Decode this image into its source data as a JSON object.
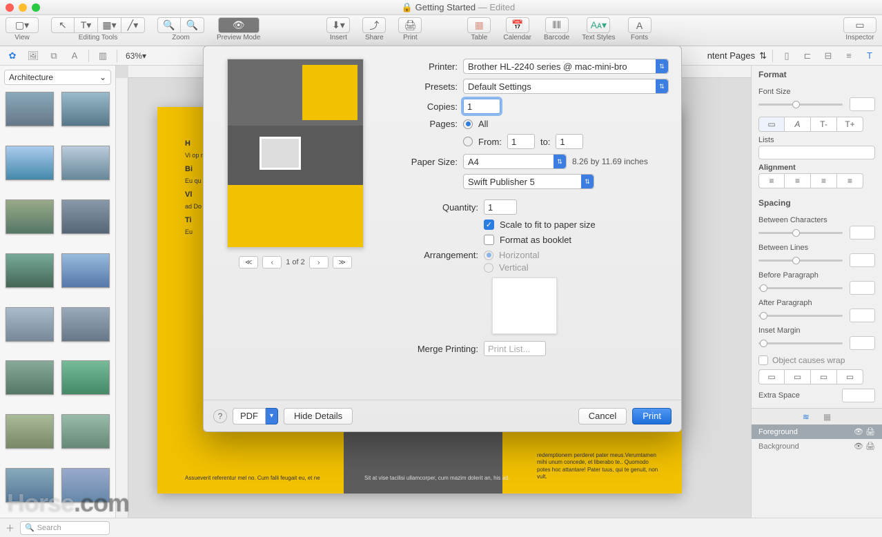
{
  "window": {
    "title": "Getting Started",
    "edited": "— Edited"
  },
  "toolbar": {
    "view": "View",
    "editing": "Editing Tools",
    "zoom": "Zoom",
    "preview": "Preview Mode",
    "insert": "Insert",
    "share": "Share",
    "print": "Print",
    "table": "Table",
    "calendar": "Calendar",
    "barcode": "Barcode",
    "textstyles": "Text Styles",
    "fonts": "Fonts",
    "inspector": "Inspector"
  },
  "secbar": {
    "zoom": "63%",
    "contentpages": "ntent Pages"
  },
  "left": {
    "category": "Architecture",
    "search_placeholder": "Search"
  },
  "right": {
    "format": "Format",
    "fontsize": "Font Size",
    "lists": "Lists",
    "alignment": "Alignment",
    "spacing": "Spacing",
    "between_chars": "Between Characters",
    "between_lines": "Between Lines",
    "before_para": "Before Paragraph",
    "after_para": "After Paragraph",
    "inset_margin": "Inset Margin",
    "wrap": "Object causes wrap",
    "extra_space": "Extra Space",
    "foreground": "Foreground",
    "background": "Background"
  },
  "dialog": {
    "printer_label": "Printer:",
    "printer_value": "Brother HL-2240 series @ mac-mini-bro",
    "presets_label": "Presets:",
    "presets_value": "Default Settings",
    "copies_label": "Copies:",
    "copies_value": "1",
    "pages_label": "Pages:",
    "pages_all": "All",
    "pages_from": "From:",
    "pages_from_v": "1",
    "pages_to": "to:",
    "pages_to_v": "1",
    "papersize_label": "Paper Size:",
    "papersize_value": "A4",
    "papersize_dim": "8.26 by 11.69 inches",
    "app_value": "Swift Publisher 5",
    "quantity_label": "Quantity:",
    "quantity_value": "1",
    "scale_fit": "Scale to fit to paper size",
    "booklet": "Format as booklet",
    "arrangement_label": "Arrangement:",
    "arr_h": "Horizontal",
    "arr_v": "Vertical",
    "merge_label": "Merge Printing:",
    "merge_btn": "Print List...",
    "page_indicator": "1 of 2",
    "pdf": "PDF",
    "hide_details": "Hide Details",
    "cancel": "Cancel",
    "print": "Print"
  },
  "watermark": {
    "a": "Horse",
    "b": ".com"
  }
}
